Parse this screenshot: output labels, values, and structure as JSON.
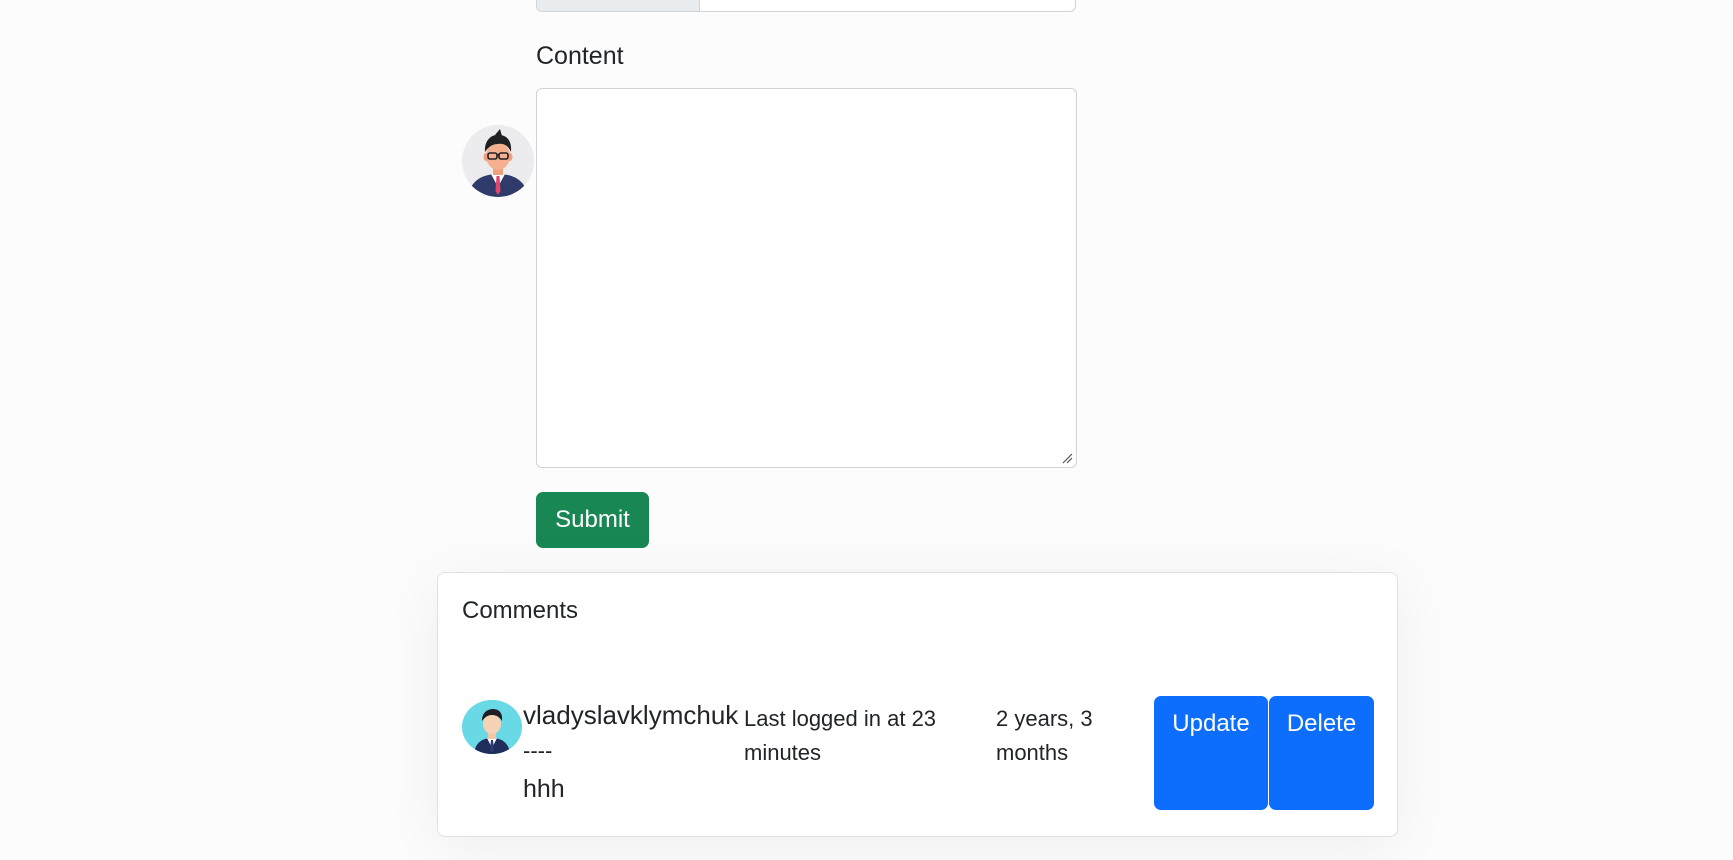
{
  "form": {
    "content_label": "Content",
    "content_value": "",
    "submit_label": "Submit"
  },
  "comments": {
    "title": "Comments",
    "items": [
      {
        "username": "vladyslavklymchuk",
        "separator": "----",
        "body": "hhh",
        "last_logged": "Last logged in at 23 minutes",
        "time_ago": "2 years, 3 months",
        "update_label": "Update",
        "delete_label": "Delete"
      }
    ]
  },
  "colors": {
    "submit": "#198754",
    "primary": "#0d6efd",
    "avatar_bg": "#6ad9e6"
  },
  "icons": {
    "form_avatar": "businessman-avatar-icon",
    "comment_avatar": "user-avatar-icon"
  }
}
